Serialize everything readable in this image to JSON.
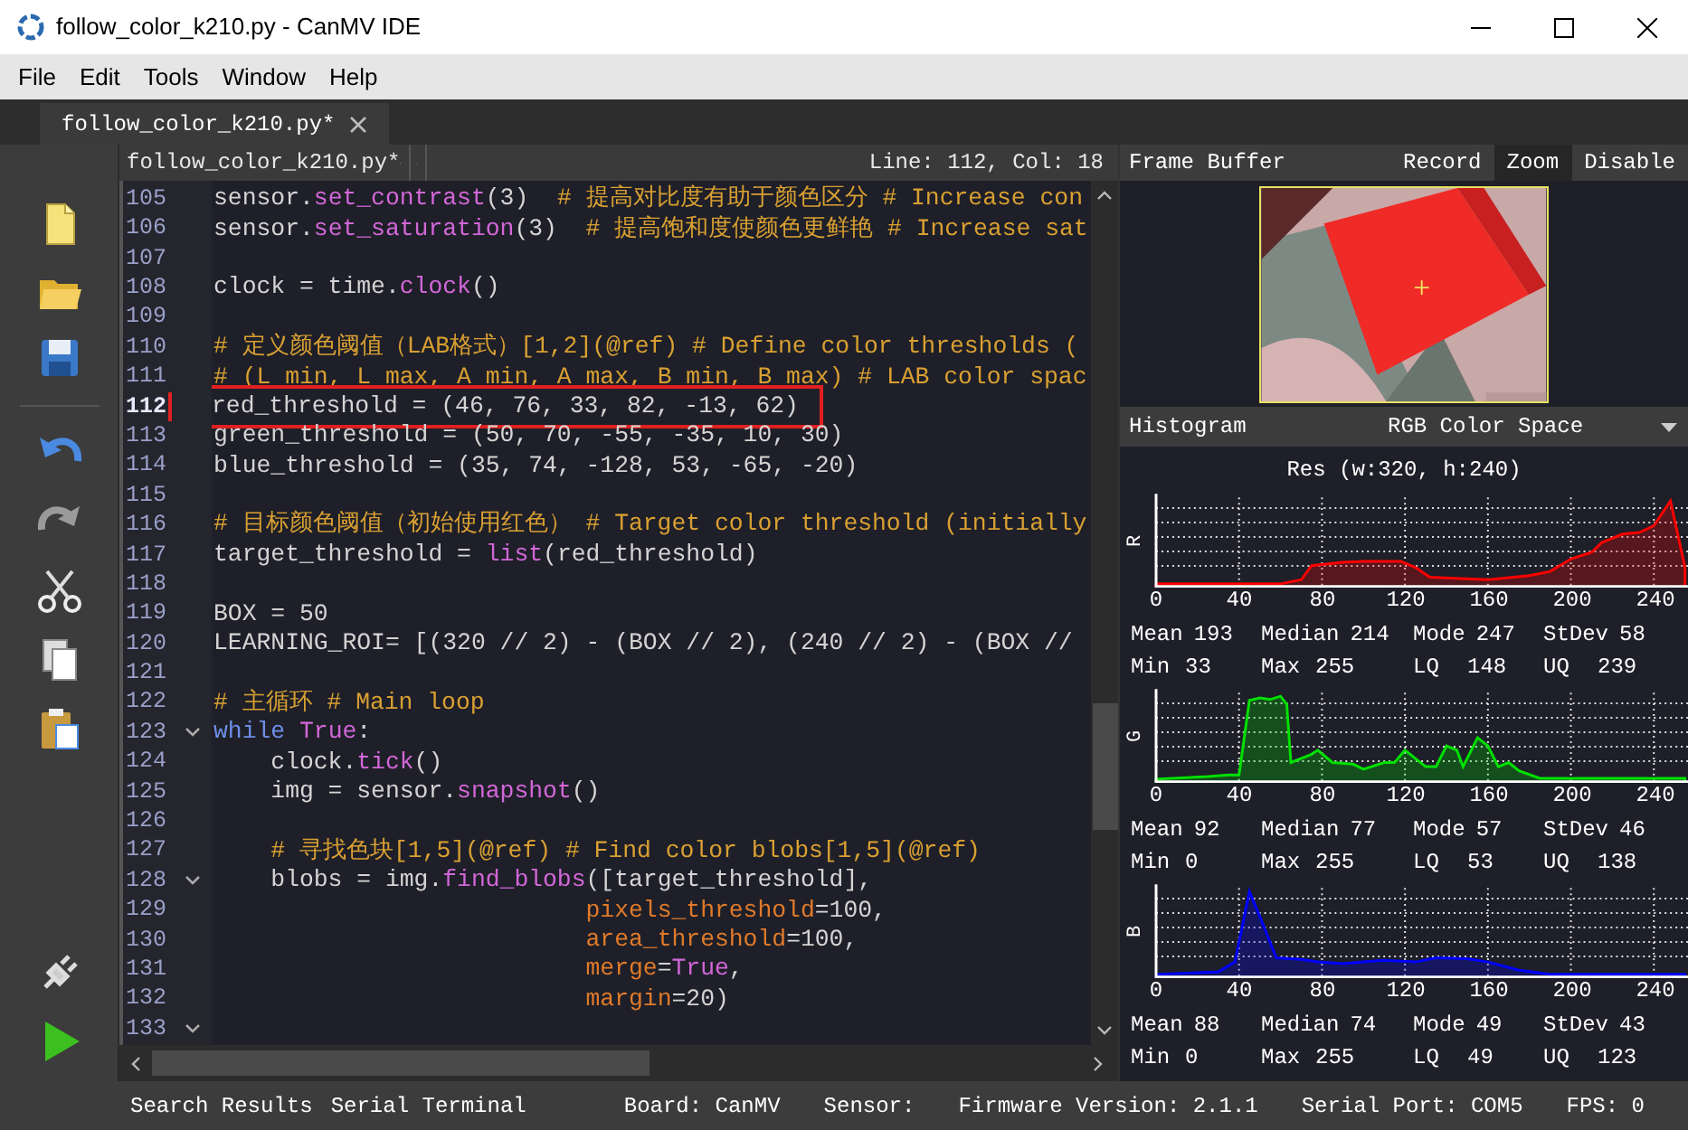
{
  "window": {
    "title": "follow_color_k210.py - CanMV IDE"
  },
  "menu": [
    "File",
    "Edit",
    "Tools",
    "Window",
    "Help"
  ],
  "file_tabs": [
    {
      "label": "follow_color_k210.py*",
      "selected": true
    }
  ],
  "editor": {
    "file": "follow_color_k210.py*",
    "position": "Line: 112, Col: 18",
    "lines": [
      {
        "number": "105",
        "tokens": [
          {
            "kind": "plain",
            "text": "sensor."
          },
          {
            "kind": "call",
            "text": "set_contrast"
          },
          {
            "kind": "plain",
            "text": "(3)"
          },
          {
            "kind": "comment",
            "text": "  # 提高对比度有助于颜色区分 # Increase con"
          }
        ]
      },
      {
        "number": "106",
        "tokens": [
          {
            "kind": "plain",
            "text": "sensor."
          },
          {
            "kind": "call",
            "text": "set_saturation"
          },
          {
            "kind": "plain",
            "text": "(3)"
          },
          {
            "kind": "comment",
            "text": "  # 提高饱和度使颜色更鲜艳 # Increase sat"
          }
        ]
      },
      {
        "number": "107"
      },
      {
        "number": "108",
        "tokens": [
          {
            "kind": "plain",
            "text": "clock = time."
          },
          {
            "kind": "call",
            "text": "clock"
          },
          {
            "kind": "plain",
            "text": "()"
          }
        ]
      },
      {
        "number": "109"
      },
      {
        "number": "110",
        "tokens": [
          {
            "kind": "comment",
            "text": "# 定义颜色阈值（LAB格式）[1,2](@ref) # Define color thresholds ("
          }
        ]
      },
      {
        "number": "111",
        "tokens": [
          {
            "kind": "comment",
            "text": "# (L min, L max, A min, A max, B min, B max) # LAB color spac"
          }
        ]
      },
      {
        "number": "112",
        "current": true,
        "highlighted": true,
        "tokens": [
          {
            "kind": "plain",
            "text": "red_threshold = (46, 76, 33, 82, -13, 62)"
          }
        ]
      },
      {
        "number": "113",
        "tokens": [
          {
            "kind": "plain",
            "text": "green_threshold = (50, 70, -55, -35, 10, 30)"
          }
        ]
      },
      {
        "number": "114",
        "tokens": [
          {
            "kind": "plain",
            "text": "blue_threshold = (35, 74, -128, 53, -65, -20)"
          }
        ]
      },
      {
        "number": "115"
      },
      {
        "number": "116",
        "tokens": [
          {
            "kind": "comment",
            "text": "# 目标颜色阈值（初始使用红色） # Target color threshold (initially"
          }
        ]
      },
      {
        "number": "117",
        "tokens": [
          {
            "kind": "plain",
            "text": "target_threshold = "
          },
          {
            "kind": "call",
            "text": "list"
          },
          {
            "kind": "plain",
            "text": "(red_threshold)"
          }
        ]
      },
      {
        "number": "118"
      },
      {
        "number": "119",
        "tokens": [
          {
            "kind": "plain",
            "text": "BOX = 50"
          }
        ]
      },
      {
        "number": "120",
        "tokens": [
          {
            "kind": "plain",
            "text": "LEARNING_ROI= [(320 // 2) - (BOX // 2), (240 // 2) - (BOX //"
          }
        ]
      },
      {
        "number": "121"
      },
      {
        "number": "122",
        "tokens": [
          {
            "kind": "comment",
            "text": "# 主循环 # Main loop"
          }
        ]
      },
      {
        "number": "123",
        "fold": true,
        "tokens": [
          {
            "kind": "keyword",
            "text": "while"
          },
          {
            "kind": "constant",
            "text": " True"
          },
          {
            "kind": "plain",
            "text": ":"
          }
        ]
      },
      {
        "number": "124",
        "tokens": [
          {
            "kind": "plain",
            "text": "    clock."
          },
          {
            "kind": "call",
            "text": "tick"
          },
          {
            "kind": "plain",
            "text": "()"
          }
        ]
      },
      {
        "number": "125",
        "tokens": [
          {
            "kind": "plain",
            "text": "    img = sensor."
          },
          {
            "kind": "call",
            "text": "snapshot"
          },
          {
            "kind": "plain",
            "text": "()"
          }
        ]
      },
      {
        "number": "126"
      },
      {
        "number": "127",
        "tokens": [
          {
            "kind": "comment",
            "text": "    # 寻找色块[1,5](@ref) # Find color blobs[1,5](@ref)"
          }
        ]
      },
      {
        "number": "128",
        "fold": true,
        "tokens": [
          {
            "kind": "plain",
            "text": "    blobs = img."
          },
          {
            "kind": "call",
            "text": "find_blobs"
          },
          {
            "kind": "plain",
            "text": "([target_threshold],"
          }
        ]
      },
      {
        "number": "129",
        "tokens": [
          {
            "kind": "param",
            "text": "                          pixels_threshold"
          },
          {
            "kind": "plain",
            "text": "=100,"
          }
        ]
      },
      {
        "number": "130",
        "tokens": [
          {
            "kind": "param",
            "text": "                          area_threshold"
          },
          {
            "kind": "plain",
            "text": "=100,"
          }
        ]
      },
      {
        "number": "131",
        "tokens": [
          {
            "kind": "param",
            "text": "                          merge"
          },
          {
            "kind": "plain",
            "text": "="
          },
          {
            "kind": "constant",
            "text": "True"
          },
          {
            "kind": "plain",
            "text": ","
          }
        ]
      },
      {
        "number": "132",
        "tokens": [
          {
            "kind": "param",
            "text": "                          margin"
          },
          {
            "kind": "plain",
            "text": "=20)"
          }
        ]
      },
      {
        "number": "133",
        "fold": true
      }
    ]
  },
  "frame_buffer": {
    "title": "Frame Buffer",
    "buttons": [
      {
        "label": "Record",
        "selected": false
      },
      {
        "label": "Zoom",
        "selected": true
      },
      {
        "label": "Disable",
        "selected": false
      }
    ]
  },
  "histogram": {
    "title": "Histogram",
    "color_space": "RGB Color Space",
    "resolution": "Res (w:320, h:240)",
    "channels": [
      {
        "axis": "R",
        "color": "#ff0000",
        "ticks": [
          "0",
          "40",
          "80",
          "120",
          "160",
          "200",
          "240"
        ],
        "stats": [
          {
            "label": "Mean",
            "value": "193"
          },
          {
            "label": "Median",
            "value": "214"
          },
          {
            "label": "Mode",
            "value": "247"
          },
          {
            "label": "StDev",
            "value": "58"
          },
          {
            "label": "Min",
            "value": "33"
          },
          {
            "label": "Max",
            "value": "255"
          },
          {
            "label": "LQ",
            "value": "148"
          },
          {
            "label": "UQ",
            "value": "239"
          }
        ]
      },
      {
        "axis": "G",
        "color": "#00e000",
        "ticks": [
          "0",
          "40",
          "80",
          "120",
          "160",
          "200",
          "240"
        ],
        "stats": [
          {
            "label": "Mean",
            "value": "92"
          },
          {
            "label": "Median",
            "value": "77"
          },
          {
            "label": "Mode",
            "value": "57"
          },
          {
            "label": "StDev",
            "value": "46"
          },
          {
            "label": "Min",
            "value": "0"
          },
          {
            "label": "Max",
            "value": "255"
          },
          {
            "label": "LQ",
            "value": "53"
          },
          {
            "label": "UQ",
            "value": "138"
          }
        ]
      },
      {
        "axis": "B",
        "color": "#0000ff",
        "ticks": [
          "0",
          "40",
          "80",
          "120",
          "160",
          "200",
          "240"
        ],
        "stats": [
          {
            "label": "Mean",
            "value": "88"
          },
          {
            "label": "Median",
            "value": "74"
          },
          {
            "label": "Mode",
            "value": "49"
          },
          {
            "label": "StDev",
            "value": "43"
          },
          {
            "label": "Min",
            "value": "0"
          },
          {
            "label": "Max",
            "value": "255"
          },
          {
            "label": "LQ",
            "value": "49"
          },
          {
            "label": "UQ",
            "value": "123"
          }
        ]
      }
    ]
  },
  "status_bar": {
    "tabs": [
      "Search Results",
      "Serial Terminal"
    ],
    "items": [
      "Board: CanMV",
      "Sensor:",
      "Firmware Version: 2.1.1",
      "Serial Port: COM5",
      "FPS: 0"
    ]
  }
}
